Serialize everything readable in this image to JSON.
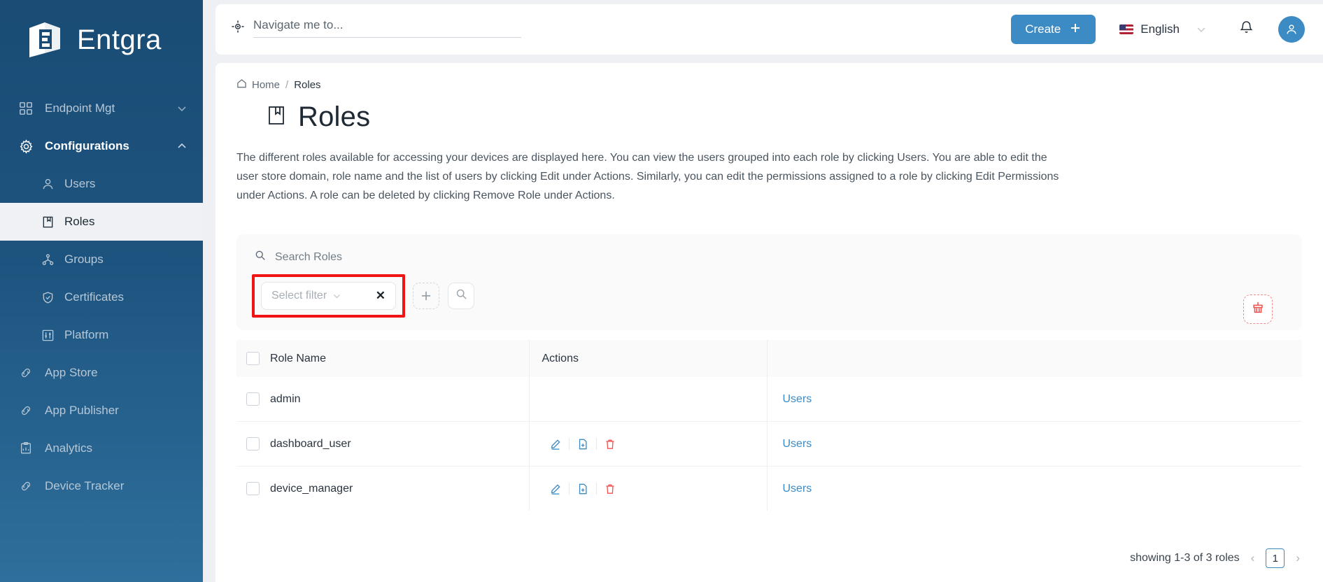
{
  "brand": {
    "name": "Entgra",
    "logo_icon": "entgra-logo-icon"
  },
  "sidebar": {
    "items": [
      {
        "label": "Endpoint Mgt",
        "icon": "grid-icon",
        "chevron": "chevron-down-icon",
        "state": "collapsed"
      },
      {
        "label": "Configurations",
        "icon": "gear-icon",
        "chevron": "chevron-up-icon",
        "state": "expanded"
      }
    ],
    "sub_items": [
      {
        "label": "Users",
        "icon": "user-icon",
        "active": false
      },
      {
        "label": "Roles",
        "icon": "book-icon",
        "active": true
      },
      {
        "label": "Groups",
        "icon": "group-icon",
        "active": false
      },
      {
        "label": "Certificates",
        "icon": "shield-check-icon",
        "active": false
      },
      {
        "label": "Platform",
        "icon": "sliders-icon",
        "active": false
      }
    ],
    "bottom_items": [
      {
        "label": "App Store",
        "icon": "link-icon"
      },
      {
        "label": "App Publisher",
        "icon": "link-icon"
      },
      {
        "label": "Analytics",
        "icon": "clipboard-icon"
      },
      {
        "label": "Device Tracker",
        "icon": "link-icon"
      }
    ]
  },
  "topbar": {
    "navigate_placeholder": "Navigate me to...",
    "navigate_icon": "target-icon",
    "create_label": "Create",
    "create_icon": "plus-icon",
    "language": "English",
    "language_flag": "us-flag-icon",
    "language_chevron": "chevron-down-icon",
    "bell_icon": "bell-icon",
    "avatar_icon": "user-avatar-icon"
  },
  "breadcrumb": {
    "home": "Home",
    "separator": "/",
    "current": "Roles",
    "home_icon": "home-icon"
  },
  "page": {
    "title": "Roles",
    "title_icon": "book-icon",
    "description": "The different roles available for accessing your devices are displayed here. You can view the users grouped into each role by clicking Users. You are able to edit the user store domain, role name and the list of users by clicking Edit under Actions. Similarly, you can edit the permissions assigned to a role by clicking Edit Permissions under Actions. A role can be deleted by clicking Remove Role under Actions."
  },
  "toolbar": {
    "search_placeholder": "Search Roles",
    "search_icon": "search-icon",
    "select_filter_label": "Select filter",
    "select_filter_chevron": "chevron-down-icon",
    "clear_filter_icon": "close-icon",
    "add_filter_icon": "plus-icon",
    "run_search_icon": "search-icon",
    "clear_all_icon": "broom-icon",
    "highlight_color": "#f01414"
  },
  "table": {
    "columns": [
      "Role Name",
      "Actions"
    ],
    "rows": [
      {
        "name": "admin",
        "actions": [],
        "users_label": "Users"
      },
      {
        "name": "dashboard_user",
        "actions": [
          "edit-icon",
          "file-plus-icon",
          "trash-icon"
        ],
        "users_label": "Users"
      },
      {
        "name": "device_manager",
        "actions": [
          "edit-icon",
          "file-plus-icon",
          "trash-icon"
        ],
        "users_label": "Users"
      }
    ]
  },
  "pagination": {
    "summary": "showing 1-3 of 3 roles",
    "prev_icon": "chevron-left-icon",
    "next_icon": "chevron-right-icon",
    "current_page": "1"
  },
  "colors": {
    "accent": "#3d8bc4",
    "sidebar_top": "#1a4c75",
    "sidebar_bottom": "#2f6f9c",
    "danger": "#f05252",
    "highlight": "#f01414"
  }
}
